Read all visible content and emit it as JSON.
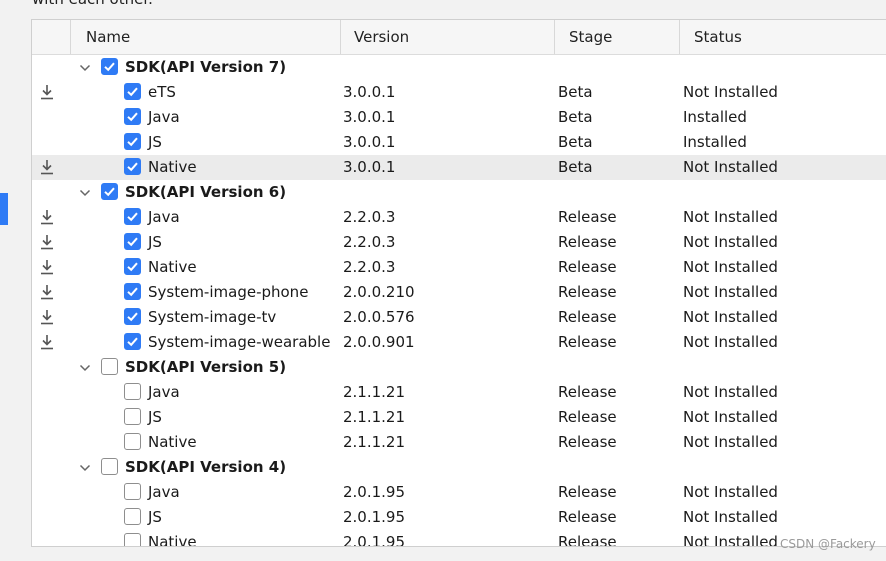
{
  "intro_text": "with each other.",
  "columns": {
    "name": "Name",
    "version": "Version",
    "stage": "Stage",
    "status": "Status"
  },
  "rows": [
    {
      "type": "group",
      "name": "SDK(API Version 7)",
      "checked": true,
      "download": false,
      "selected": false,
      "version": "",
      "stage": "",
      "status": ""
    },
    {
      "type": "item",
      "name": "eTS",
      "checked": true,
      "download": true,
      "selected": false,
      "version": "3.0.0.1",
      "stage": "Beta",
      "status": "Not Installed"
    },
    {
      "type": "item",
      "name": "Java",
      "checked": true,
      "download": false,
      "selected": false,
      "version": "3.0.0.1",
      "stage": "Beta",
      "status": "Installed"
    },
    {
      "type": "item",
      "name": "JS",
      "checked": true,
      "download": false,
      "selected": false,
      "version": "3.0.0.1",
      "stage": "Beta",
      "status": "Installed"
    },
    {
      "type": "item",
      "name": "Native",
      "checked": true,
      "download": true,
      "selected": true,
      "version": "3.0.0.1",
      "stage": "Beta",
      "status": "Not Installed"
    },
    {
      "type": "group",
      "name": "SDK(API Version 6)",
      "checked": true,
      "download": false,
      "selected": false,
      "version": "",
      "stage": "",
      "status": ""
    },
    {
      "type": "item",
      "name": "Java",
      "checked": true,
      "download": true,
      "selected": false,
      "version": "2.2.0.3",
      "stage": "Release",
      "status": "Not Installed"
    },
    {
      "type": "item",
      "name": "JS",
      "checked": true,
      "download": true,
      "selected": false,
      "version": "2.2.0.3",
      "stage": "Release",
      "status": "Not Installed"
    },
    {
      "type": "item",
      "name": "Native",
      "checked": true,
      "download": true,
      "selected": false,
      "version": "2.2.0.3",
      "stage": "Release",
      "status": "Not Installed"
    },
    {
      "type": "item",
      "name": "System-image-phone",
      "checked": true,
      "download": true,
      "selected": false,
      "version": "2.0.0.210",
      "stage": "Release",
      "status": "Not Installed"
    },
    {
      "type": "item",
      "name": "System-image-tv",
      "checked": true,
      "download": true,
      "selected": false,
      "version": "2.0.0.576",
      "stage": "Release",
      "status": "Not Installed"
    },
    {
      "type": "item",
      "name": "System-image-wearable",
      "checked": true,
      "download": true,
      "selected": false,
      "version": "2.0.0.901",
      "stage": "Release",
      "status": "Not Installed"
    },
    {
      "type": "group",
      "name": "SDK(API Version 5)",
      "checked": false,
      "download": false,
      "selected": false,
      "version": "",
      "stage": "",
      "status": ""
    },
    {
      "type": "item",
      "name": "Java",
      "checked": false,
      "download": false,
      "selected": false,
      "version": "2.1.1.21",
      "stage": "Release",
      "status": "Not Installed"
    },
    {
      "type": "item",
      "name": "JS",
      "checked": false,
      "download": false,
      "selected": false,
      "version": "2.1.1.21",
      "stage": "Release",
      "status": "Not Installed"
    },
    {
      "type": "item",
      "name": "Native",
      "checked": false,
      "download": false,
      "selected": false,
      "version": "2.1.1.21",
      "stage": "Release",
      "status": "Not Installed"
    },
    {
      "type": "group",
      "name": "SDK(API Version 4)",
      "checked": false,
      "download": false,
      "selected": false,
      "version": "",
      "stage": "",
      "status": ""
    },
    {
      "type": "item",
      "name": "Java",
      "checked": false,
      "download": false,
      "selected": false,
      "version": "2.0.1.95",
      "stage": "Release",
      "status": "Not Installed"
    },
    {
      "type": "item",
      "name": "JS",
      "checked": false,
      "download": false,
      "selected": false,
      "version": "2.0.1.95",
      "stage": "Release",
      "status": "Not Installed"
    },
    {
      "type": "item",
      "name": "Native",
      "checked": false,
      "download": false,
      "selected": false,
      "version": "2.0.1.95",
      "stage": "Release",
      "status": "Not Installed"
    }
  ],
  "icons": {
    "download": "download-icon",
    "expand": "chevron-down-icon",
    "check": "checkmark-icon"
  },
  "colors": {
    "accent": "#2f7bf5",
    "selected_row": "#ebebeb",
    "header_bg": "#f6f6f6"
  },
  "watermark": "CSDN @Fackery"
}
